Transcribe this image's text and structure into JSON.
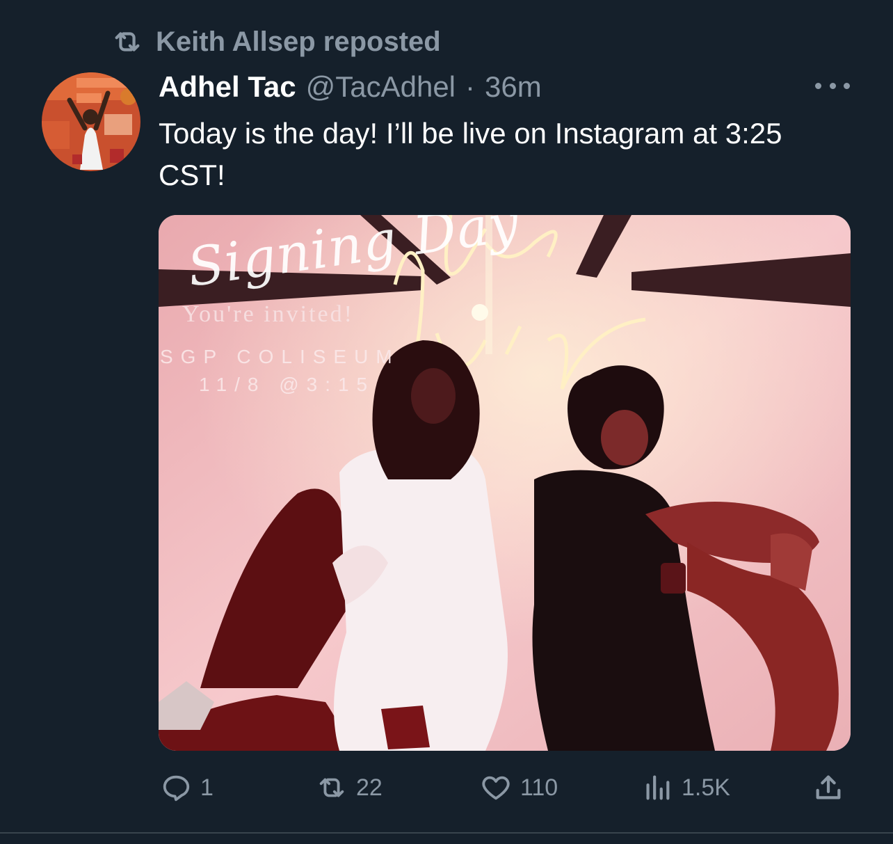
{
  "repost": {
    "label": "Keith Allsep reposted",
    "icon": "repost-icon"
  },
  "tweet": {
    "author_name": "Adhel Tac",
    "handle": "@TacAdhel",
    "separator": "·",
    "time": "36m",
    "text": "Today is the day! I’ll be live on Instagram at 3:25 CST!",
    "more_icon": "more-icon"
  },
  "media": {
    "overlay": {
      "script_title": "Signing Day",
      "invited": "You're invited!",
      "venue": "SGP COLISEUM",
      "date": "11/8 @3:15"
    }
  },
  "actions": {
    "reply_count": "1",
    "repost_count": "22",
    "like_count": "110",
    "views_count": "1.5K"
  },
  "colors": {
    "background": "#15202b",
    "secondary_text": "#8b98a5",
    "primary_text": "#ffffff",
    "divider": "#38444d"
  }
}
